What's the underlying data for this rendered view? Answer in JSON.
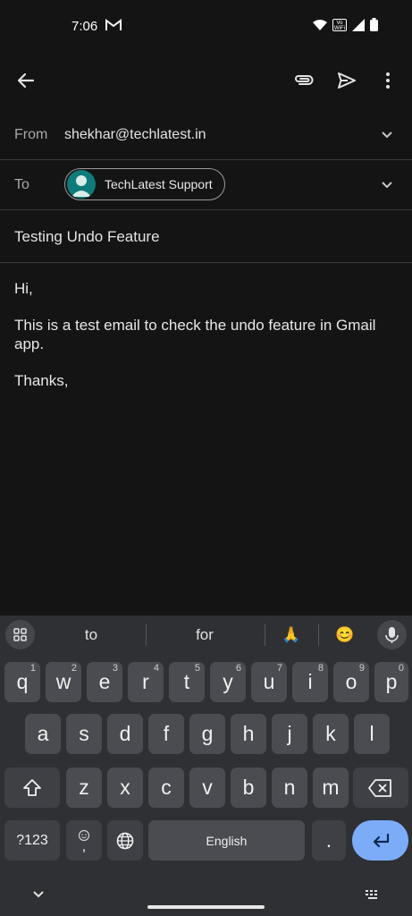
{
  "status_bar": {
    "time": "7:06",
    "gmail_icon": "gmail-m-icon",
    "wifi_label": "Vo WiFi"
  },
  "toolbar": {
    "back_icon": "arrow-back-icon",
    "attach_icon": "paperclip-icon",
    "send_icon": "send-icon",
    "more_icon": "more-vert-icon"
  },
  "compose": {
    "from_label": "From",
    "from_value": "shekhar@techlatest.in",
    "to_label": "To",
    "to_chip": "TechLatest Support",
    "subject": "Testing Undo Feature",
    "body": [
      "Hi,",
      "This is a test email to check the undo feature in Gmail app.",
      "Thanks,"
    ]
  },
  "keyboard": {
    "suggestions": [
      "to",
      "for",
      "🙏",
      "😊"
    ],
    "row1": [
      [
        "q",
        "1"
      ],
      [
        "w",
        "2"
      ],
      [
        "e",
        "3"
      ],
      [
        "r",
        "4"
      ],
      [
        "t",
        "5"
      ],
      [
        "y",
        "6"
      ],
      [
        "u",
        "7"
      ],
      [
        "i",
        "8"
      ],
      [
        "o",
        "9"
      ],
      [
        "p",
        "0"
      ]
    ],
    "row2": [
      "a",
      "s",
      "d",
      "f",
      "g",
      "h",
      "j",
      "k",
      "l"
    ],
    "row3": [
      "z",
      "x",
      "c",
      "v",
      "b",
      "n",
      "m"
    ],
    "symbols_key": "?123",
    "comma_key": ",",
    "space_label": "English",
    "period_key": ".",
    "accent": "#7cacf8"
  }
}
